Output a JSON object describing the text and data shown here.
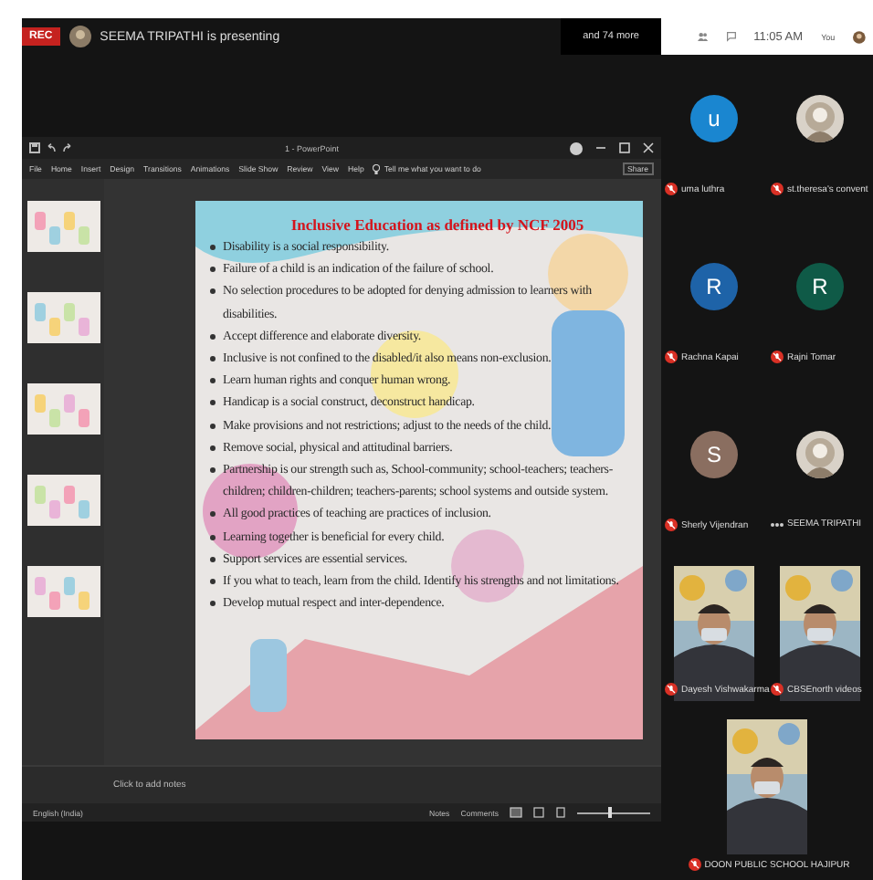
{
  "meeting_bar": {
    "recording": "REC",
    "presenter": "SEEMA TRIPATHI is presenting",
    "more": "and 74 more"
  },
  "header": {
    "time": "11:05 AM",
    "you": "You"
  },
  "powerpoint": {
    "title": "1 - PowerPoint",
    "ribbon_tabs": [
      "File",
      "Home",
      "Insert",
      "Design",
      "Transitions",
      "Animations",
      "Slide Show",
      "Review",
      "View",
      "Help"
    ],
    "search": "Tell me what you want to do",
    "share": "Share",
    "slide": {
      "title": "Inclusive Education as defined by NCF 2005",
      "bullets": [
        "Disability is a social responsibility.",
        "Failure of a child is an indication of the failure of school.",
        "No selection procedures to be adopted for denying admission to learners with disabilities.",
        "Accept difference and elaborate diversity.",
        "Inclusive is not confined to the disabled/it also means non-exclusion.",
        "Learn human rights and conquer human wrong.",
        "Handicap is a social construct, deconstruct handicap.",
        "Make provisions and not restrictions; adjust to the needs of the child.",
        "Remove social, physical and attitudinal barriers.",
        "Partnership is our strength such as, School-community; school-teachers; teachers-children; children-children; teachers-parents; school systems and outside system.",
        "All good practices of teaching are practices of inclusion.",
        "Learning together is beneficial for every child.",
        "Support services are essential services.",
        "If you what to teach, learn from the child. Identify his strengths and not limitations.",
        "Develop mutual respect and inter-dependence."
      ]
    },
    "zoom": {
      "level": 0.45
    },
    "notes_placeholder": "Click to add notes",
    "status": {
      "language": "English (India)",
      "notes": "Notes",
      "comments": "Comments"
    }
  },
  "participants": [
    {
      "name": "uma luthra",
      "kind": "initial",
      "initial": "u",
      "color": "#1a86d0",
      "muted": true
    },
    {
      "name": "st.theresa's convent",
      "muted": true
    },
    {
      "name": "Rachna Kapai",
      "kind": "initial",
      "initial": "R",
      "color": "#1e63a8",
      "muted": true
    },
    {
      "name": "Rajni Tomar",
      "kind": "initial",
      "initial": "R",
      "color": "#0f5a47",
      "muted": true
    },
    {
      "name": "Sherly Vijendran",
      "kind": "initial",
      "initial": "S",
      "color": "#8a6e60",
      "muted": true
    },
    {
      "name": "SEEMA TRIPATHI",
      "muted": false
    },
    {
      "name": "Dayesh Vishwakarma",
      "kind": "video",
      "muted": true
    },
    {
      "name": "CBSEnorth videos",
      "kind": "video",
      "muted": true
    },
    {
      "name": "DOON PUBLIC SCHOOL HAJIPUR",
      "kind": "video",
      "muted": true
    }
  ]
}
